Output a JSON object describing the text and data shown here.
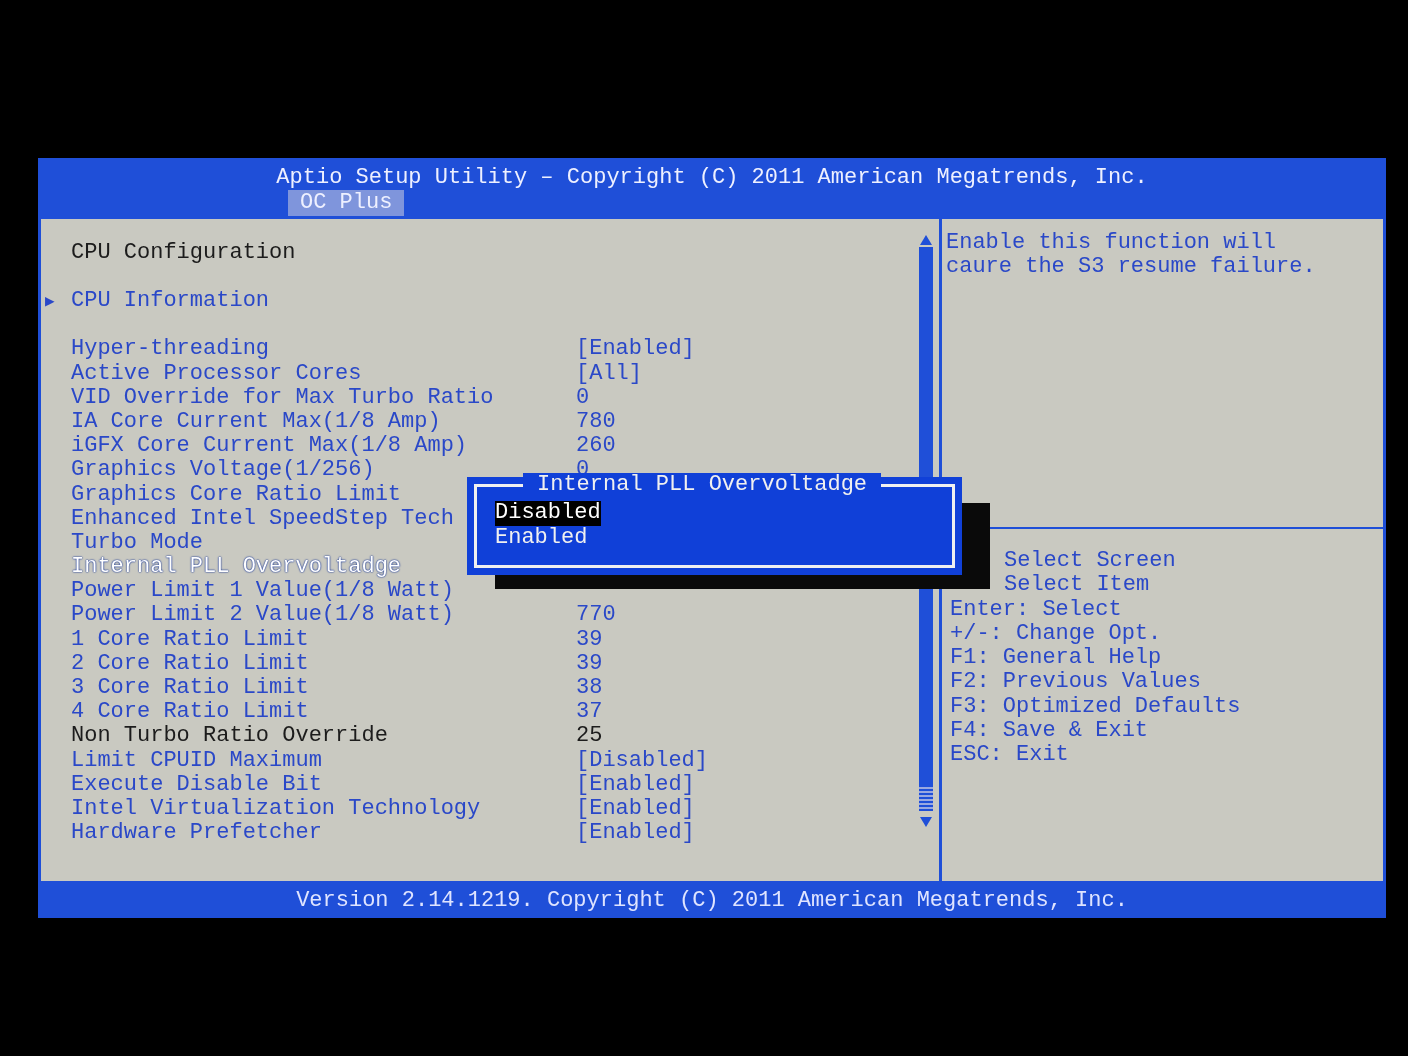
{
  "header": {
    "title": "Aptio Setup Utility – Copyright (C) 2011 American Megatrends, Inc.",
    "tabs": [
      {
        "label": "OC Plus",
        "selected": true
      }
    ]
  },
  "settings": {
    "items": [
      {
        "kind": "heading",
        "label": "CPU Configuration"
      },
      {
        "kind": "submenu",
        "marker": "▶",
        "label": "CPU Information",
        "selected": false
      },
      {
        "kind": "option",
        "label": "Hyper-threading",
        "value": "[Enabled]",
        "selected": false
      },
      {
        "kind": "option",
        "label": "Active Processor Cores",
        "value": "[All]",
        "selected": false
      },
      {
        "kind": "option",
        "label": "VID Override for Max Turbo Ratio",
        "value": "0",
        "selected": false
      },
      {
        "kind": "option",
        "label": "IA Core Current Max(1/8 Amp)",
        "value": "780",
        "selected": false
      },
      {
        "kind": "option",
        "label": "iGFX Core Current Max(1/8 Amp)",
        "value": "260",
        "selected": false
      },
      {
        "kind": "option",
        "label": "Graphics Voltage(1/256)",
        "value": "0",
        "selected": false
      },
      {
        "kind": "option",
        "label": "Graphics Core Ratio Limit",
        "selected": false
      },
      {
        "kind": "option",
        "label": "Enhanced Intel SpeedStep Tech",
        "selected": false
      },
      {
        "kind": "option",
        "label": "Turbo Mode",
        "selected": false
      },
      {
        "kind": "option",
        "label": "Internal PLL Overvoltadge",
        "selected": true
      },
      {
        "kind": "option",
        "label": "Power Limit 1 Value(1/8 Watt)",
        "selected": false
      },
      {
        "kind": "option",
        "label": "Power Limit 2 Value(1/8 Watt)",
        "value": "770",
        "selected": false
      },
      {
        "kind": "option",
        "label": "1 Core Ratio Limit",
        "value": "39",
        "selected": false
      },
      {
        "kind": "option",
        "label": "2 Core Ratio Limit",
        "value": "39",
        "selected": false
      },
      {
        "kind": "option",
        "label": "3 Core Ratio Limit",
        "value": "38",
        "selected": false
      },
      {
        "kind": "option",
        "label": "4 Core Ratio Limit",
        "value": "37",
        "selected": false
      },
      {
        "kind": "static",
        "label": "Non Turbo Ratio Override",
        "value": "25",
        "selected": false
      },
      {
        "kind": "option",
        "label": "Limit CPUID Maximum",
        "value": "[Disabled]",
        "selected": false
      },
      {
        "kind": "option",
        "label": "Execute Disable Bit",
        "value": "[Enabled]",
        "selected": false
      },
      {
        "kind": "option",
        "label": "Intel Virtualization Technology",
        "value": "[Enabled]",
        "selected": false
      },
      {
        "kind": "option",
        "label": "Hardware Prefetcher",
        "value": "[Enabled]",
        "selected": false
      }
    ]
  },
  "help": {
    "text": "Enable this function will caure the S3 resume failure.",
    "hints": [
      {
        "kind": "arrow",
        "text": "Select Screen"
      },
      {
        "kind": "arrow",
        "text": "Select Item"
      },
      {
        "kind": "key",
        "text": "Enter: Select"
      },
      {
        "kind": "key",
        "text": "+/-: Change Opt."
      },
      {
        "kind": "key",
        "text": "F1: General Help"
      },
      {
        "kind": "key",
        "text": "F2: Previous Values"
      },
      {
        "kind": "key",
        "text": "F3: Optimized Defaults"
      },
      {
        "kind": "key",
        "text": "F4: Save & Exit"
      },
      {
        "kind": "key",
        "text": "ESC: Exit"
      }
    ]
  },
  "popup": {
    "title": "Internal PLL Overvoltadge",
    "options": [
      {
        "label": "Disabled",
        "selected": true
      },
      {
        "label": "Enabled",
        "selected": false
      }
    ]
  },
  "footer": "Version 2.14.1219. Copyright (C) 2011 American Megatrends, Inc."
}
